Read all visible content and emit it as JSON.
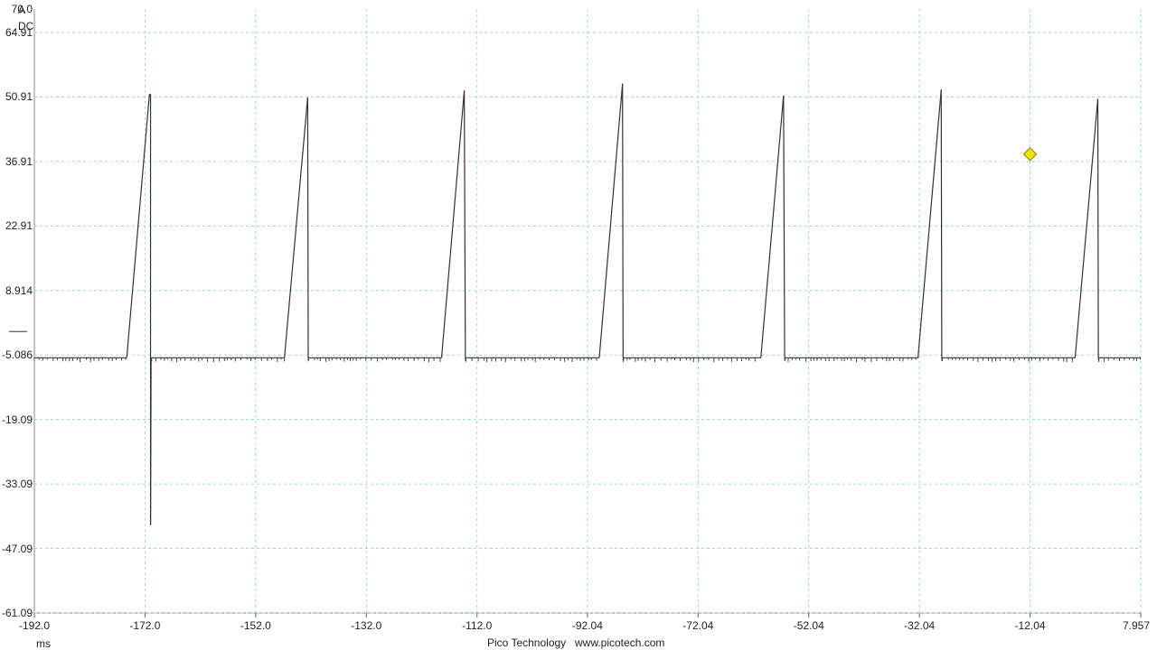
{
  "footer": {
    "brand": "Pico Technology",
    "url": "www.picotech.com"
  },
  "chart_data": {
    "type": "line",
    "title": "",
    "xlabel": "ms",
    "ylabel": "A",
    "coupling": "DC",
    "xlim": [
      -192.0,
      7.957
    ],
    "ylim": [
      -61.09,
      70.0
    ],
    "x_tick_labels": [
      "-192.0",
      "-172.0",
      "-152.0",
      "-132.0",
      "-112.0",
      "-92.04",
      "-72.04",
      "-52.04",
      "-32.04",
      "-12.04",
      "7.957"
    ],
    "x_tick_values": [
      -192.0,
      -172.0,
      -152.0,
      -132.0,
      -112.0,
      -92.04,
      -72.04,
      -52.04,
      -32.04,
      -12.04,
      7.957
    ],
    "y_tick_labels": [
      "70.0",
      "64.91",
      "50.91",
      "36.91",
      "22.91",
      "8.914",
      "-5.086",
      "-19.09",
      "-33.09",
      "-47.09",
      "-61.09"
    ],
    "y_tick_values": [
      70.0,
      64.91,
      50.91,
      36.91,
      22.91,
      8.914,
      -5.086,
      -19.09,
      -33.09,
      -47.09,
      -61.09
    ],
    "grid": true,
    "baseline": -5.086,
    "series": [
      {
        "color": "#333333",
        "x": [
          -192.0,
          -175.3,
          -171.2,
          -171.0,
          -171.0,
          -170.9,
          -170.8,
          -146.8,
          -142.6,
          -142.5,
          -142.4,
          -118.4,
          -114.3,
          -114.1,
          -114.0,
          -89.9,
          -85.7,
          -85.6,
          -85.5,
          -60.7,
          -56.6,
          -56.4,
          -56.3,
          -32.3,
          -28.1,
          -28.0,
          -27.9,
          -3.9,
          0.2,
          0.3,
          0.4,
          7.957
        ],
        "y": [
          -5.7,
          -5.7,
          51.5,
          51.5,
          -42.0,
          -5.7,
          -5.7,
          -5.7,
          50.8,
          -5.7,
          -5.7,
          -5.7,
          52.3,
          -5.7,
          -5.7,
          -5.7,
          53.8,
          -5.7,
          -5.7,
          -5.7,
          51.2,
          -5.7,
          -5.7,
          -5.7,
          52.5,
          -5.7,
          -5.7,
          -5.7,
          50.5,
          -5.7,
          -5.7,
          -5.7
        ]
      }
    ],
    "marker": {
      "shape": "diamond",
      "color": "#f5e400",
      "x": -12.04,
      "y": 38.5
    },
    "reference_tick_y": 0.0
  }
}
